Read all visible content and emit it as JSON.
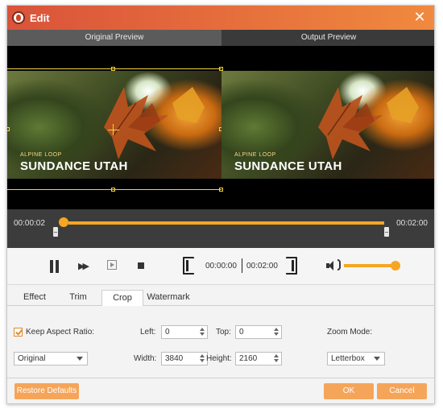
{
  "window": {
    "title": "Edit",
    "close_icon": "close-icon"
  },
  "preview": {
    "original_label": "Original Preview",
    "output_label": "Output Preview",
    "caption_small": "ALPINE LOOP",
    "caption_big": "SUNDANCE UTAH"
  },
  "timeline": {
    "start_time": "00:00:02",
    "end_time": "00:02:00",
    "progress_fraction": 0.02
  },
  "controls": {
    "icons": [
      "pause-icon",
      "fast-forward-icon",
      "next-frame-icon",
      "stop-icon",
      "set-start-icon",
      "set-end-icon",
      "volume-icon"
    ],
    "clip_start": "00:00:00",
    "clip_end": "00:02:00",
    "volume_fraction": 0.95
  },
  "tabs": [
    {
      "label": "Effect",
      "active": false
    },
    {
      "label": "Trim",
      "active": false
    },
    {
      "label": "Crop",
      "active": true
    },
    {
      "label": "Watermark",
      "active": false
    }
  ],
  "crop": {
    "keep_aspect_label": "Keep Aspect Ratio:",
    "keep_aspect_checked": true,
    "aspect_value": "Original",
    "left_label": "Left:",
    "left_value": "0",
    "top_label": "Top:",
    "top_value": "0",
    "width_label": "Width:",
    "width_value": "3840",
    "height_label": "Height:",
    "height_value": "2160",
    "zoom_label": "Zoom Mode:",
    "zoom_value": "Letterbox"
  },
  "footer": {
    "restore_label": "Restore Defaults",
    "ok_label": "OK",
    "cancel_label": "Cancel"
  },
  "colors": {
    "accent": "#f5a623",
    "titlebar_start": "#d9533a",
    "titlebar_end": "#f08a3e",
    "button": "#f5a55a"
  }
}
